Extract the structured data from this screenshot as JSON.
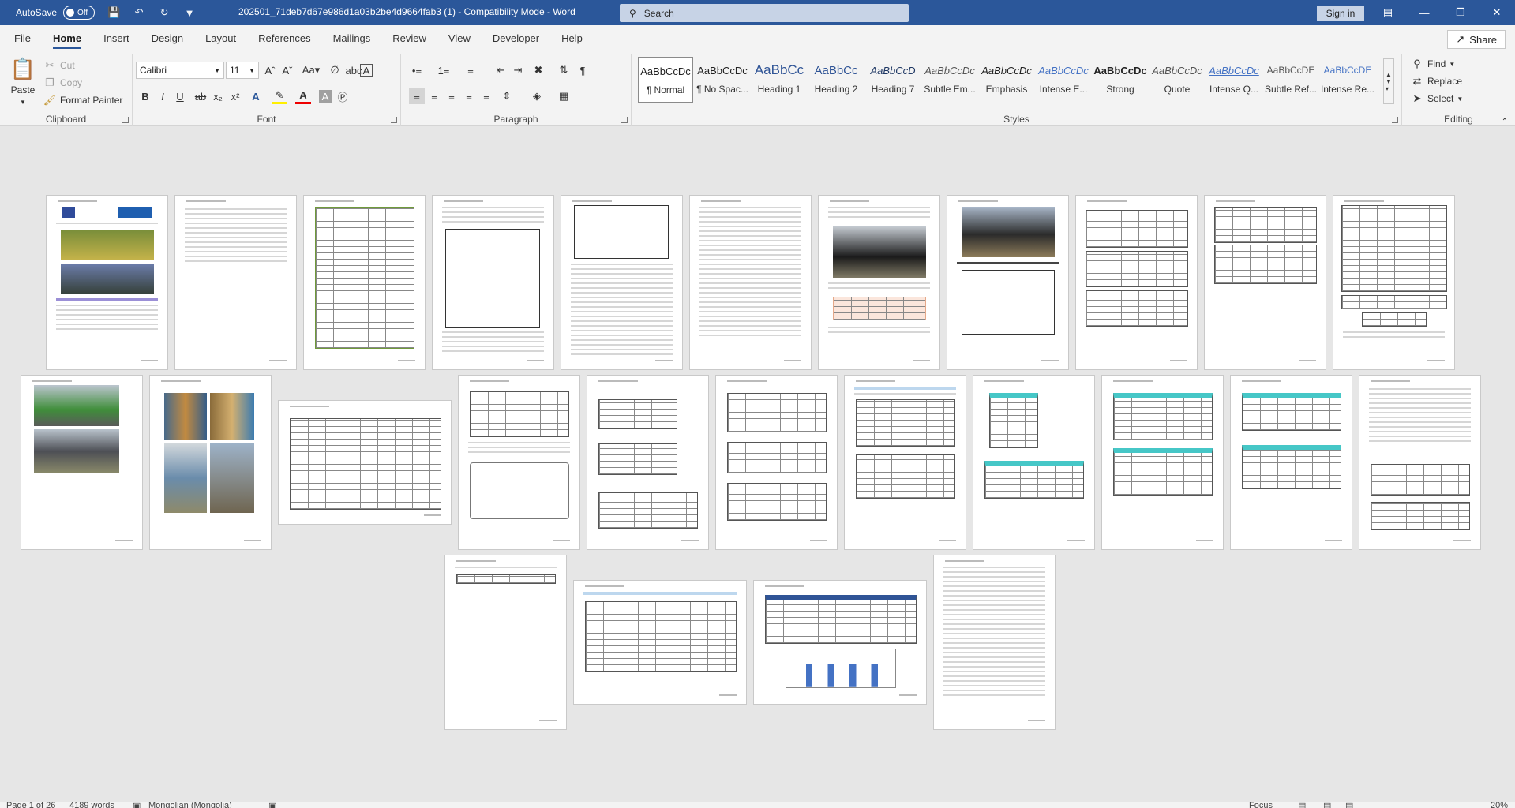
{
  "titlebar": {
    "autosave_label": "AutoSave",
    "autosave_state": "Off",
    "document_title": "202501_71deb7d67e986d1a03b2be4d9664fab3 (1)  -  Compatibility Mode  -  Word",
    "search_placeholder": "Search",
    "signin_label": "Sign in"
  },
  "tabs": [
    "File",
    "Home",
    "Insert",
    "Design",
    "Layout",
    "References",
    "Mailings",
    "Review",
    "View",
    "Developer",
    "Help"
  ],
  "share_label": "Share",
  "clipboard": {
    "paste": "Paste",
    "cut": "Cut",
    "copy": "Copy",
    "format_painter": "Format Painter",
    "label": "Clipboard"
  },
  "font": {
    "family": "Calibri",
    "size": "11",
    "label": "Font",
    "bold": "B",
    "italic": "I",
    "underline": "U",
    "strike": "ab",
    "sub": "x₂",
    "sup": "x²"
  },
  "paragraph": {
    "label": "Paragraph"
  },
  "styles": {
    "label": "Styles",
    "items": [
      {
        "sample": "AaBbCcDc",
        "name": "¶ Normal"
      },
      {
        "sample": "AaBbCcDc",
        "name": "¶ No Spac..."
      },
      {
        "sample": "AaBbCс",
        "name": "Heading 1"
      },
      {
        "sample": "AaBbCc",
        "name": "Heading 2"
      },
      {
        "sample": "AaBbCcD",
        "name": "Heading 7"
      },
      {
        "sample": "AaBbCcDс",
        "name": "Subtle Em..."
      },
      {
        "sample": "AaBbCcDс",
        "name": "Emphasis"
      },
      {
        "sample": "AaBbCcDс",
        "name": "Intense E..."
      },
      {
        "sample": "AaBbCcDс",
        "name": "Strong"
      },
      {
        "sample": "AaBbCcDс",
        "name": "Quote"
      },
      {
        "sample": "AaBbCcDс",
        "name": "Intense Q..."
      },
      {
        "sample": "AaBbCcDE",
        "name": "Subtle Ref..."
      },
      {
        "sample": "AaBbCcDE",
        "name": "Intense Re..."
      }
    ]
  },
  "editing": {
    "find": "Find",
    "replace": "Replace",
    "select": "Select",
    "label": "Editing"
  },
  "statusbar": {
    "page": "Page 1 of 26",
    "words": "4189 words",
    "language": "Mongolian (Mongolia)",
    "focus": "Focus",
    "zoom": "20%"
  }
}
